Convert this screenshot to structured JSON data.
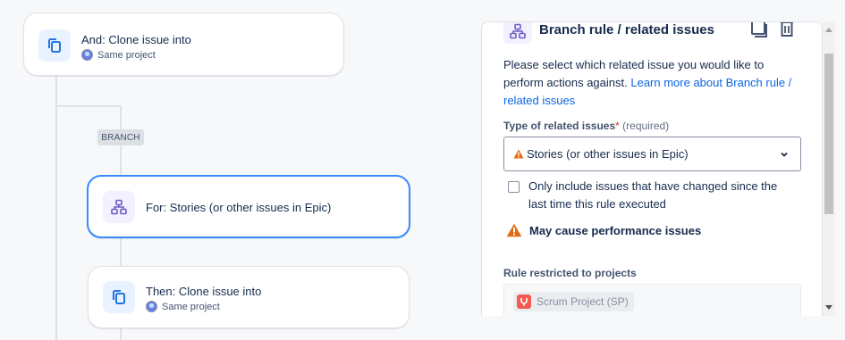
{
  "canvas": {
    "clone_card": {
      "title": "And: Clone issue into",
      "subtitle": "Same project",
      "icon": "copy-icon"
    },
    "branch_label": "BRANCH",
    "for_card": {
      "title": "For: Stories (or other issues in Epic)",
      "icon": "branch-hierarchy-icon"
    },
    "then_card": {
      "title": "Then: Clone issue into",
      "subtitle": "Same project",
      "icon": "copy-icon"
    }
  },
  "panel": {
    "title": "Branch rule / related issues",
    "header_icon": "branch-hierarchy-icon",
    "actions": [
      "copy-icon",
      "trash-icon"
    ],
    "description": "Please select which related issue you would like to perform actions against.",
    "learn_more_link": "Learn more about Branch rule / related issues",
    "field": {
      "label": "Type of related issues",
      "required_mark": "*",
      "required_text": "(required)",
      "selected_value": "Stories (or other issues in Epic)"
    },
    "checkbox_label": "Only include issues that have changed since the last time this rule executed",
    "checkbox_checked": false,
    "warning": "May cause performance issues",
    "restricted": {
      "label": "Rule restricted to projects",
      "project": "Scrum Project (SP)"
    }
  },
  "colors": {
    "accent": "#388bff",
    "link": "#0c66e4",
    "warning": "#e56910",
    "branch_purple": "#6e5dc6"
  }
}
